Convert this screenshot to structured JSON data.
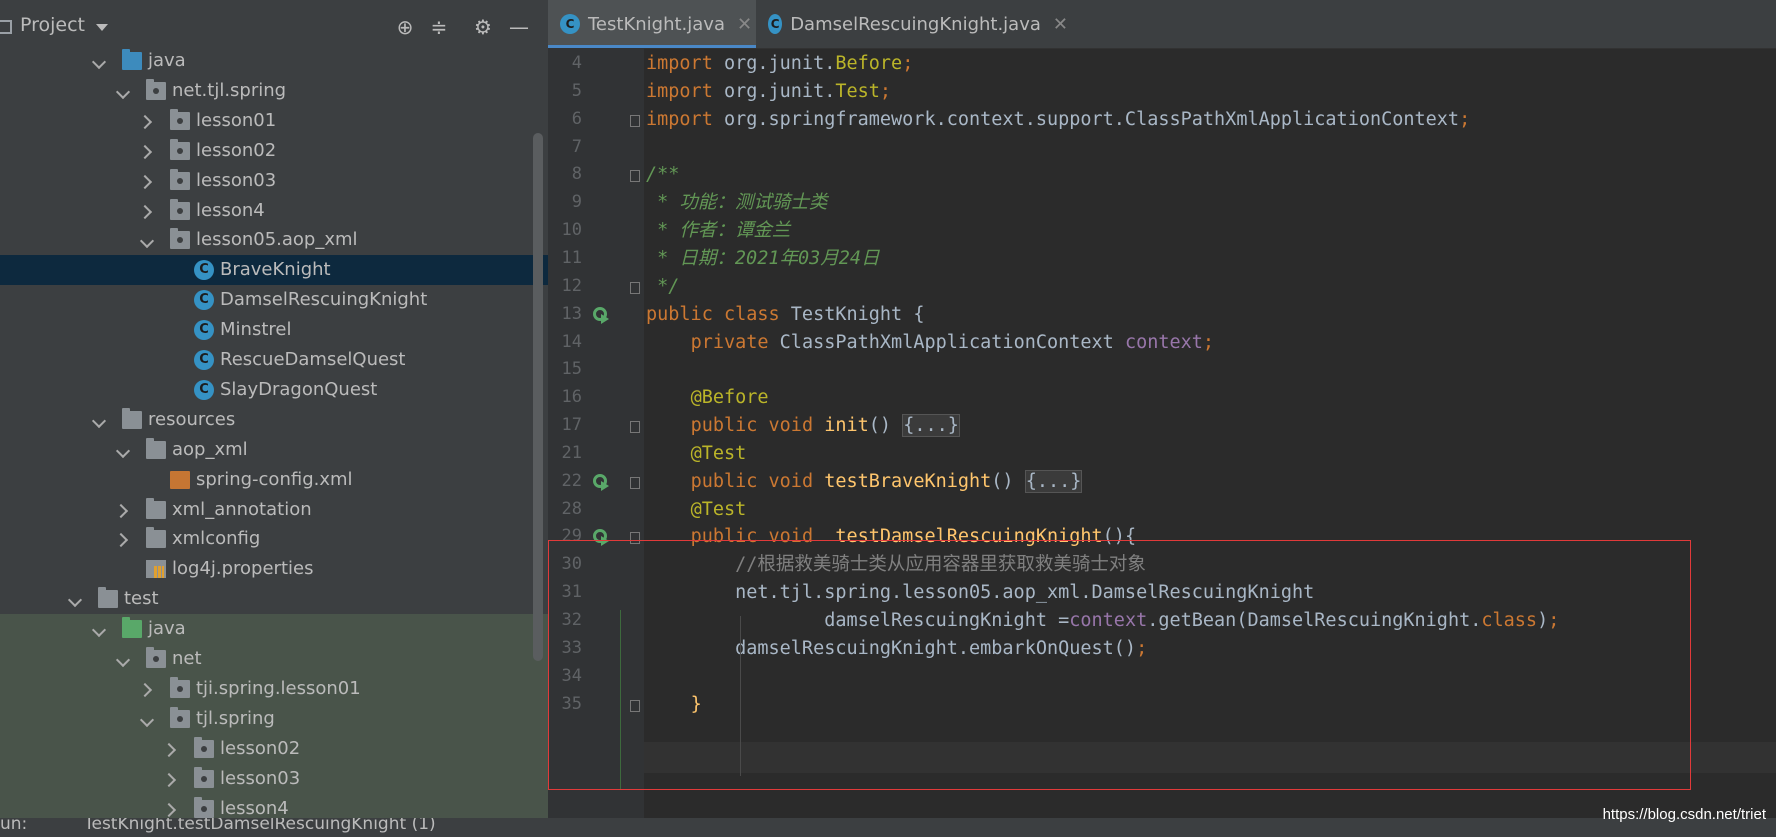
{
  "project_panel": {
    "title": "Project",
    "tree": [
      {
        "label": "java",
        "depth": 1,
        "expanded": true,
        "icon": "folder-blue"
      },
      {
        "label": "net.tjl.spring",
        "depth": 2,
        "expanded": true,
        "icon": "package"
      },
      {
        "label": "lesson01",
        "depth": 3,
        "expanded": false,
        "icon": "package"
      },
      {
        "label": "lesson02",
        "depth": 3,
        "expanded": false,
        "icon": "package"
      },
      {
        "label": "lesson03",
        "depth": 3,
        "expanded": false,
        "icon": "package"
      },
      {
        "label": "lesson4",
        "depth": 3,
        "expanded": false,
        "icon": "package"
      },
      {
        "label": "lesson05.aop_xml",
        "depth": 3,
        "expanded": true,
        "icon": "package"
      },
      {
        "label": "BraveKnight",
        "depth": 4,
        "icon": "class",
        "selected": true
      },
      {
        "label": "DamselRescuingKnight",
        "depth": 4,
        "icon": "class"
      },
      {
        "label": "Minstrel",
        "depth": 4,
        "icon": "class"
      },
      {
        "label": "RescueDamselQuest",
        "depth": 4,
        "icon": "class"
      },
      {
        "label": "SlayDragonQuest",
        "depth": 4,
        "icon": "class"
      },
      {
        "label": "resources",
        "depth": 1,
        "expanded": true,
        "icon": "folder-resources"
      },
      {
        "label": "aop_xml",
        "depth": 2,
        "expanded": true,
        "icon": "folder"
      },
      {
        "label": "spring-config.xml",
        "depth": 3,
        "icon": "xml"
      },
      {
        "label": "xml_annotation",
        "depth": 2,
        "expanded": false,
        "icon": "folder"
      },
      {
        "label": "xmlconfig",
        "depth": 2,
        "expanded": false,
        "icon": "folder"
      },
      {
        "label": "log4j.properties",
        "depth": 2,
        "icon": "properties"
      },
      {
        "label": "test",
        "depth": 0,
        "expanded": true,
        "icon": "folder"
      },
      {
        "label": "java",
        "depth": 1,
        "expanded": true,
        "icon": "folder-green",
        "test": true
      },
      {
        "label": "net",
        "depth": 2,
        "expanded": true,
        "icon": "package",
        "test": true
      },
      {
        "label": "tji.spring.lesson01",
        "depth": 3,
        "expanded": false,
        "icon": "package",
        "test": true
      },
      {
        "label": "tjl.spring",
        "depth": 3,
        "expanded": true,
        "icon": "package",
        "test": true
      },
      {
        "label": "lesson02",
        "depth": 4,
        "expanded": false,
        "icon": "package",
        "test": true
      },
      {
        "label": "lesson03",
        "depth": 4,
        "expanded": false,
        "icon": "package",
        "test": true
      },
      {
        "label": "lesson4",
        "depth": 4,
        "expanded": false,
        "icon": "package",
        "test": true
      }
    ]
  },
  "tabs": [
    {
      "label": "TestKnight.java",
      "active": true,
      "icon": "test-class-icon"
    },
    {
      "label": "DamselRescuingKnight.java",
      "active": false,
      "icon": "class-icon"
    }
  ],
  "code_lines": [
    {
      "n": "4",
      "tokens": [
        [
          "kw",
          "import "
        ],
        [
          "",
          "org.junit."
        ],
        [
          "ann",
          "Before"
        ],
        [
          "kw",
          ";"
        ]
      ]
    },
    {
      "n": "5",
      "tokens": [
        [
          "kw",
          "import "
        ],
        [
          "",
          "org.junit."
        ],
        [
          "ann",
          "Test"
        ],
        [
          "kw",
          ";"
        ]
      ]
    },
    {
      "n": "6",
      "fold": true,
      "tokens": [
        [
          "kw",
          "import "
        ],
        [
          "",
          "org.springframework.context.support.ClassPathXmlApplicationContext"
        ],
        [
          "kw",
          ";"
        ]
      ]
    },
    {
      "n": "7",
      "tokens": []
    },
    {
      "n": "8",
      "fold": true,
      "tokens": [
        [
          "doc",
          "/**"
        ]
      ]
    },
    {
      "n": "9",
      "tokens": [
        [
          "doc",
          " * 功能：测试骑士类"
        ]
      ]
    },
    {
      "n": "10",
      "tokens": [
        [
          "doc",
          " * 作者：谭金兰"
        ]
      ]
    },
    {
      "n": "11",
      "tokens": [
        [
          "doc",
          " * 日期：2021年03月24日"
        ]
      ]
    },
    {
      "n": "12",
      "fold": true,
      "tokens": [
        [
          "doc",
          " */"
        ]
      ]
    },
    {
      "n": "13",
      "run": true,
      "tokens": [
        [
          "kw",
          "public class "
        ],
        [
          "",
          "TestKnight {"
        ]
      ]
    },
    {
      "n": "14",
      "tokens": [
        [
          "",
          "    "
        ],
        [
          "kw",
          "private "
        ],
        [
          "",
          "ClassPathXmlApplicationContext "
        ],
        [
          "fld",
          "context"
        ],
        [
          "kw",
          ";"
        ]
      ]
    },
    {
      "n": "15",
      "tokens": []
    },
    {
      "n": "16",
      "tokens": [
        [
          "",
          "    "
        ],
        [
          "ann",
          "@Before"
        ]
      ]
    },
    {
      "n": "17",
      "fold": true,
      "tokens": [
        [
          "",
          "    "
        ],
        [
          "kw",
          "public void "
        ],
        [
          "mth",
          "init"
        ],
        [
          "",
          "() "
        ],
        [
          "fold",
          "{...}"
        ]
      ]
    },
    {
      "n": "21",
      "tokens": [
        [
          "",
          "    "
        ],
        [
          "ann",
          "@Test"
        ]
      ]
    },
    {
      "n": "22",
      "run": true,
      "fold": true,
      "tokens": [
        [
          "",
          "    "
        ],
        [
          "kw",
          "public void "
        ],
        [
          "mth",
          "testBraveKnight"
        ],
        [
          "",
          "() "
        ],
        [
          "fold",
          "{...}"
        ]
      ]
    },
    {
      "n": "28",
      "tokens": [
        [
          "",
          "    "
        ],
        [
          "ann",
          "@Test"
        ]
      ]
    },
    {
      "n": "29",
      "run": true,
      "fold": true,
      "tokens": [
        [
          "",
          "    "
        ],
        [
          "kw",
          "public void  "
        ],
        [
          "mth",
          "testDamselRescuingKnight"
        ],
        [
          "",
          "(){"
        ]
      ]
    },
    {
      "n": "30",
      "tokens": [
        [
          "",
          "        "
        ],
        [
          "cmt",
          "//根据救美骑士类从应用容器里获取救美骑士对象"
        ]
      ]
    },
    {
      "n": "31",
      "tokens": [
        [
          "",
          "        net.tjl.spring.lesson05.aop_xml.DamselRescuingKnight"
        ]
      ]
    },
    {
      "n": "32",
      "tokens": [
        [
          "",
          "                damselRescuingKnight ="
        ],
        [
          "fld",
          "context"
        ],
        [
          "",
          ".getBean(DamselRescuingKnight."
        ],
        [
          "kw",
          "class"
        ],
        [
          "",
          ")"
        ],
        [
          "kw",
          ";"
        ]
      ]
    },
    {
      "n": "33",
      "tokens": [
        [
          "",
          "        damselRescuingKnight.embarkOnQuest()"
        ],
        [
          "kw",
          ";"
        ]
      ]
    },
    {
      "n": "34",
      "tokens": []
    },
    {
      "n": "35",
      "fold": true,
      "tokens": [
        [
          "",
          "    "
        ],
        [
          "mth",
          "}"
        ]
      ]
    }
  ],
  "status_bar": {
    "run_label": "TestKnight.testDamselRescuingKnight (1)",
    "prefix": "un:"
  },
  "watermark": "https://blog.csdn.net/triet",
  "colors": {
    "keyword": "#cc7832",
    "annotation": "#bbb529",
    "field": "#9876aa",
    "method": "#ffc66d",
    "doc": "#629755",
    "highlight_box": "#e13a3a"
  }
}
